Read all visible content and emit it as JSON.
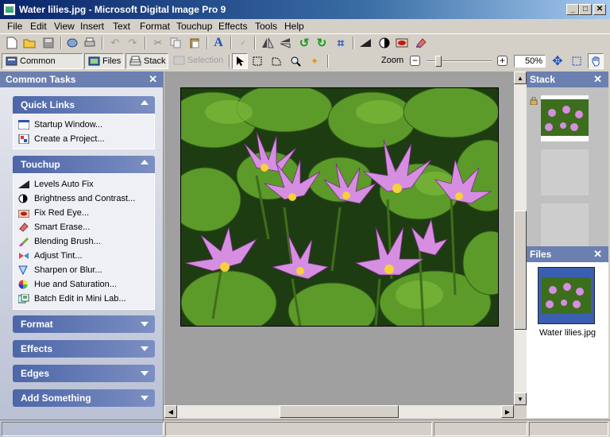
{
  "window": {
    "title": "Water lilies.jpg - Microsoft Digital Image Pro 9"
  },
  "menu": [
    "File",
    "Edit",
    "View",
    "Insert",
    "Text",
    "Format",
    "Touchup",
    "Effects",
    "Tools",
    "Help"
  ],
  "pane_tabs": {
    "common_tasks": "Common Tasks",
    "files": "Files",
    "stack": "Stack",
    "selection": "Selection"
  },
  "zoom": {
    "label": "Zoom",
    "value": "50%",
    "slider_fraction": 0.18
  },
  "left_pane": {
    "title": "Common Tasks",
    "sections": {
      "quick_links": {
        "title": "Quick Links",
        "items": [
          "Startup Window...",
          "Create a Project..."
        ]
      },
      "touchup": {
        "title": "Touchup",
        "items": [
          "Levels Auto Fix",
          "Brightness and Contrast...",
          "Fix Red Eye...",
          "Smart Erase...",
          "Blending Brush...",
          "Adjust Tint...",
          "Sharpen or Blur...",
          "Hue and Saturation...",
          "Batch Edit in Mini Lab..."
        ]
      },
      "format": {
        "title": "Format"
      },
      "effects": {
        "title": "Effects"
      },
      "edges": {
        "title": "Edges"
      },
      "add_something": {
        "title": "Add Something"
      }
    }
  },
  "right_pane": {
    "stack": {
      "title": "Stack"
    },
    "files": {
      "title": "Files",
      "filename": "Water lilies.jpg"
    }
  },
  "colors": {
    "pane_header": "#6b7fb0",
    "section_header": "#4c66a8",
    "title_bar": "#0a246a",
    "canvas_bg": "#a0a0a0"
  }
}
